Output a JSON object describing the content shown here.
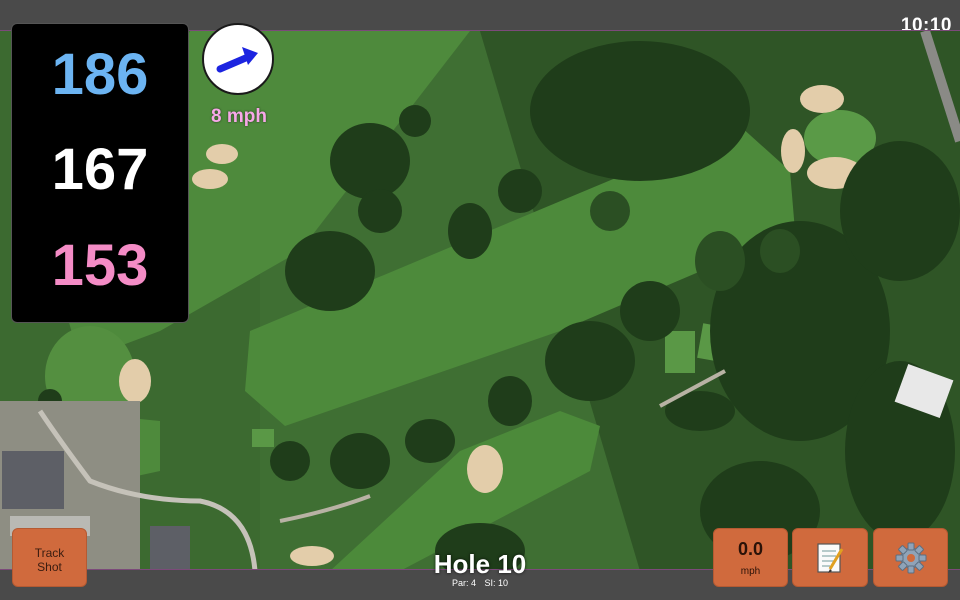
{
  "status": {
    "time": "10:10"
  },
  "yardage": {
    "back": "186",
    "middle": "167",
    "front": "153"
  },
  "wind": {
    "label": "8 mph",
    "direction_icon": "arrow-right-up-icon"
  },
  "buttons": {
    "track_shot": [
      "Track",
      "Shot"
    ],
    "speed": {
      "value": "0.0",
      "unit": "mph"
    },
    "notes_icon": "notepad-icon",
    "settings_icon": "gear-icon"
  },
  "hole": {
    "title": "Hole 10",
    "par": "Par: 4",
    "si": "SI: 10"
  },
  "colors": {
    "back": "#6cb4f2",
    "middle": "#ffffff",
    "front": "#f48cc6",
    "button": "#d06a3d",
    "wind_label": "#f7a8e8"
  }
}
